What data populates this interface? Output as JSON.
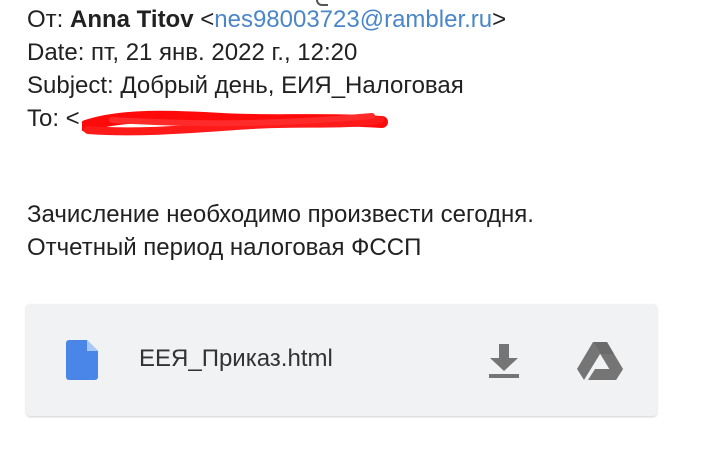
{
  "email": {
    "from_prefix": "От: ",
    "from_name": "Anna Titov",
    "from_open": " <",
    "from_email": "nes98003723@rambler.ru",
    "from_close": ">",
    "date_line": "Date: пт, 21 янв. 2022 г., 12:20",
    "subject_line": "Subject: Добрый день, ЕИЯ_Налоговая",
    "to_prefix": "To: <",
    "body_line_1": "Зачисление необходимо произвести сегодня.",
    "body_line_2": "Отчетный период налоговая ФССП"
  },
  "attachment": {
    "file_name": "ЕЕЯ_Приказ.html",
    "file_icon": "document-icon",
    "actions": [
      "download-icon",
      "google-drive-icon"
    ]
  },
  "colors": {
    "link": "#4a86c8",
    "redaction": "#ff0a0a",
    "file_icon": "#4a86e8",
    "action_icon": "#757575",
    "card_bg": "#f1f2f4"
  }
}
